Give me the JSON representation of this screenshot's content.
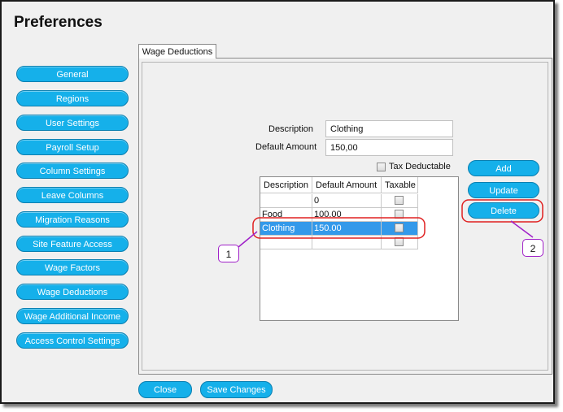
{
  "window": {
    "title": "Preferences"
  },
  "sidebar": {
    "items": [
      {
        "label": "General"
      },
      {
        "label": "Regions"
      },
      {
        "label": "User Settings"
      },
      {
        "label": "Payroll Setup"
      },
      {
        "label": "Column Settings"
      },
      {
        "label": "Leave Columns"
      },
      {
        "label": "Migration Reasons"
      },
      {
        "label": "Site Feature Access"
      },
      {
        "label": "Wage Factors"
      },
      {
        "label": "Wage Deductions"
      },
      {
        "label": "Wage Additional Income"
      },
      {
        "label": "Access Control Settings"
      }
    ]
  },
  "tab": {
    "label": "Wage Deductions"
  },
  "form": {
    "description_label": "Description",
    "description_value": "Clothing",
    "default_amount_label": "Default Amount",
    "default_amount_value": "150,00",
    "tax_deductable_label": "Tax Deductable",
    "tax_deductable_checked": false
  },
  "grid": {
    "columns": [
      "Description",
      "Default Amount",
      "Taxable"
    ],
    "rows": [
      {
        "description": "",
        "amount": "0",
        "taxable": false,
        "selected": false
      },
      {
        "description": "Food",
        "amount": "100.00",
        "taxable": false,
        "selected": false
      },
      {
        "description": "Clothing",
        "amount": "150.00",
        "taxable": false,
        "selected": true
      },
      {
        "description": "",
        "amount": "",
        "taxable": false,
        "selected": false
      }
    ]
  },
  "actions": {
    "add": "Add",
    "update": "Update",
    "delete": "Delete"
  },
  "footer": {
    "close": "Close",
    "save": "Save Changes"
  },
  "callouts": {
    "one": "1",
    "two": "2"
  },
  "colors": {
    "accent": "#15b0ea",
    "selection": "#3399ea",
    "highlight": "#e02020",
    "callout_border": "#a020c8"
  }
}
